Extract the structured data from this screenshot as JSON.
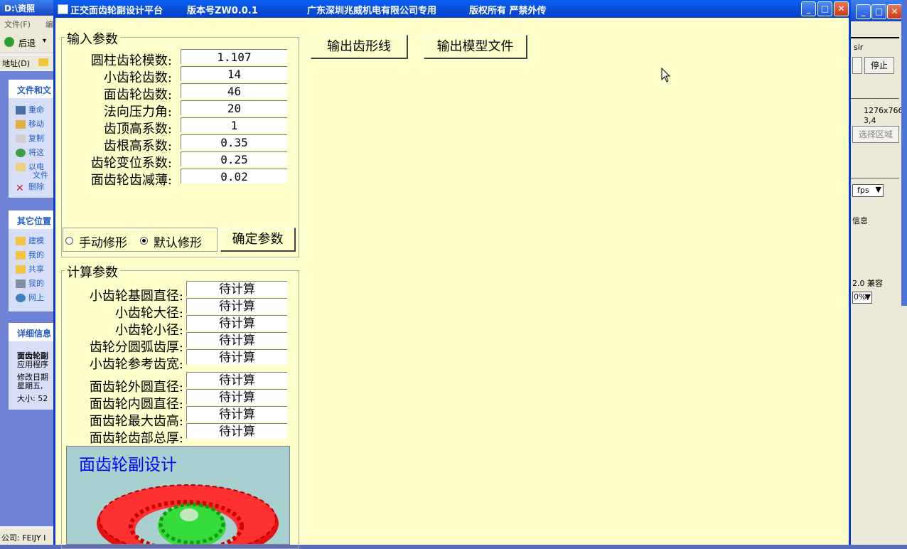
{
  "background_window": {
    "title": "D:\\资照",
    "menu": [
      "文件(F)",
      "编"
    ],
    "back_label": "后退",
    "address_label": "地址(D)",
    "tasks_header": "文件和文",
    "tasks": [
      {
        "label": "重命",
        "icon": "rename-icon"
      },
      {
        "label": "移动",
        "icon": "move-icon"
      },
      {
        "label": "复制",
        "icon": "copy-icon"
      },
      {
        "label": "将这",
        "icon": "publish-icon"
      },
      {
        "label": "以电",
        "label2": "文件",
        "icon": "email-icon"
      },
      {
        "label": "删除",
        "icon": "delete-icon"
      }
    ],
    "places_header": "其它位置",
    "places": [
      {
        "label": "建模",
        "icon": "folder-icon"
      },
      {
        "label": "我的",
        "icon": "folder-icon"
      },
      {
        "label": "共享",
        "icon": "folder-icon"
      },
      {
        "label": "我的",
        "icon": "computer-icon"
      },
      {
        "label": "网上",
        "icon": "network-icon"
      }
    ],
    "details_header": "详细信息",
    "details_name": "面齿轮副",
    "details_type": "应用程序",
    "details_modified": "修改日期",
    "details_day": "星期五,",
    "details_size": "大小: 52",
    "status_text": "公司: FEIJY I"
  },
  "right_window": {
    "field_text": "sir",
    "stop_label": "停止",
    "resolution": "1276x766",
    "coords": "3,4",
    "select_region_label": "选择区域",
    "fps_label": "fps",
    "info_label": "信息",
    "compat_label": "2.0 兼容",
    "percent_label": "0%"
  },
  "app": {
    "title_name": "正交面齿轮副设计平台",
    "title_version": "版本号ZW0.0.1",
    "title_company": "广东深圳兆威机电有限公司专用",
    "title_copyright": "版权所有 严禁外传",
    "input_group_label": "输入参数",
    "inputs": [
      {
        "label": "圆柱齿轮模数:",
        "value": "1.107"
      },
      {
        "label": "小齿轮齿数:",
        "value": "14"
      },
      {
        "label": "面齿轮齿数:",
        "value": "46"
      },
      {
        "label": "法向压力角:",
        "value": "20"
      },
      {
        "label": "齿顶高系数:",
        "value": "1"
      },
      {
        "label": "齿根高系数:",
        "value": "0.35"
      },
      {
        "label": "齿轮变位系数:",
        "value": "0.25"
      },
      {
        "label": "面齿轮齿减薄:",
        "value": "0.02"
      }
    ],
    "radio_manual": "手动修形",
    "radio_default": "默认修形",
    "radio_selected": "default",
    "confirm_button": "确定参数",
    "output_profile_button": "输出齿形线",
    "output_model_button": "输出模型文件",
    "calc_group_label": "计算参数",
    "calc_group1": [
      {
        "label": "小齿轮基圆直径:",
        "value": "待计算"
      },
      {
        "label": "小齿轮大径:",
        "value": "待计算"
      },
      {
        "label": "小齿轮小径:",
        "value": "待计算"
      },
      {
        "label": "齿轮分圆弧齿厚:",
        "value": "待计算"
      },
      {
        "label": "小齿轮参考齿宽:",
        "value": "待计算"
      }
    ],
    "calc_group2": [
      {
        "label": "面齿轮外圆直径:",
        "value": "待计算"
      },
      {
        "label": "面齿轮内圆直径:",
        "value": "待计算"
      },
      {
        "label": "面齿轮最大齿高:",
        "value": "待计算"
      },
      {
        "label": "面齿轮齿部总厚:",
        "value": "待计算"
      }
    ],
    "image_caption": "面齿轮副设计",
    "colors": {
      "title_bar": "#0a5ff0",
      "body": "#ffffcc",
      "caption": "#0000ff",
      "gear_red": "#ee1111",
      "gear_green": "#22dd22",
      "image_bg": "#a8d0d0"
    }
  }
}
